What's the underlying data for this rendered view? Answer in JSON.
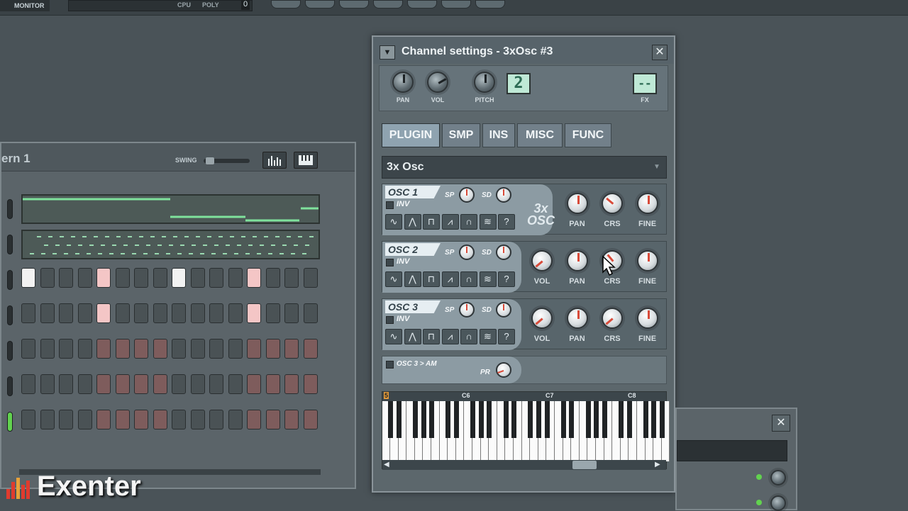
{
  "topbar": {
    "monitor_label": "MONITOR",
    "cpu_label": "CPU",
    "poly_label": "POLY",
    "poly_value": "0"
  },
  "sequencer": {
    "pattern_name": "ern 1",
    "swing_label": "SWING",
    "graph_editor_icon": "graph-icon",
    "piano_roll_icon": "keyboard-icon"
  },
  "channel": {
    "title": "Channel settings - 3xOsc #3",
    "header": {
      "pan_label": "PAN",
      "vol_label": "VOL",
      "pitch_label": "PITCH",
      "mixer_track": "2",
      "fx_value": "--",
      "fx_label": "FX"
    },
    "tabs": [
      "PLUGIN",
      "SMP",
      "INS",
      "MISC",
      "FUNC"
    ],
    "active_tab": "PLUGIN",
    "plugin_name": "3x Osc",
    "logo_line1": "3x",
    "logo_line2": "OSC",
    "oscillators": [
      {
        "label": "OSC 1",
        "inv": "INV",
        "sp": "SP",
        "sd": "SD",
        "knobs": [
          "PAN",
          "CRS",
          "FINE"
        ]
      },
      {
        "label": "OSC 2",
        "inv": "INV",
        "sp": "SP",
        "sd": "SD",
        "knobs": [
          "VOL",
          "PAN",
          "CRS",
          "FINE"
        ]
      },
      {
        "label": "OSC 3",
        "inv": "INV",
        "sp": "SP",
        "sd": "SD",
        "knobs": [
          "VOL",
          "PAN",
          "CRS",
          "FINE"
        ]
      }
    ],
    "waveforms": [
      "sine",
      "triangle",
      "square",
      "saw",
      "rounded-saw",
      "noise",
      "custom"
    ],
    "custom_wave_label": "?",
    "am_label": "OSC 3 > AM",
    "pr_label": "PR",
    "keyboard": {
      "root_marker": "5",
      "octave_labels": [
        "C6",
        "C7",
        "C8"
      ]
    }
  },
  "watermark": {
    "text": "Exenter"
  },
  "colors": {
    "accent_red": "#d84b3a",
    "lcd_green": "#bfe9d6",
    "led_green": "#62d24f"
  }
}
